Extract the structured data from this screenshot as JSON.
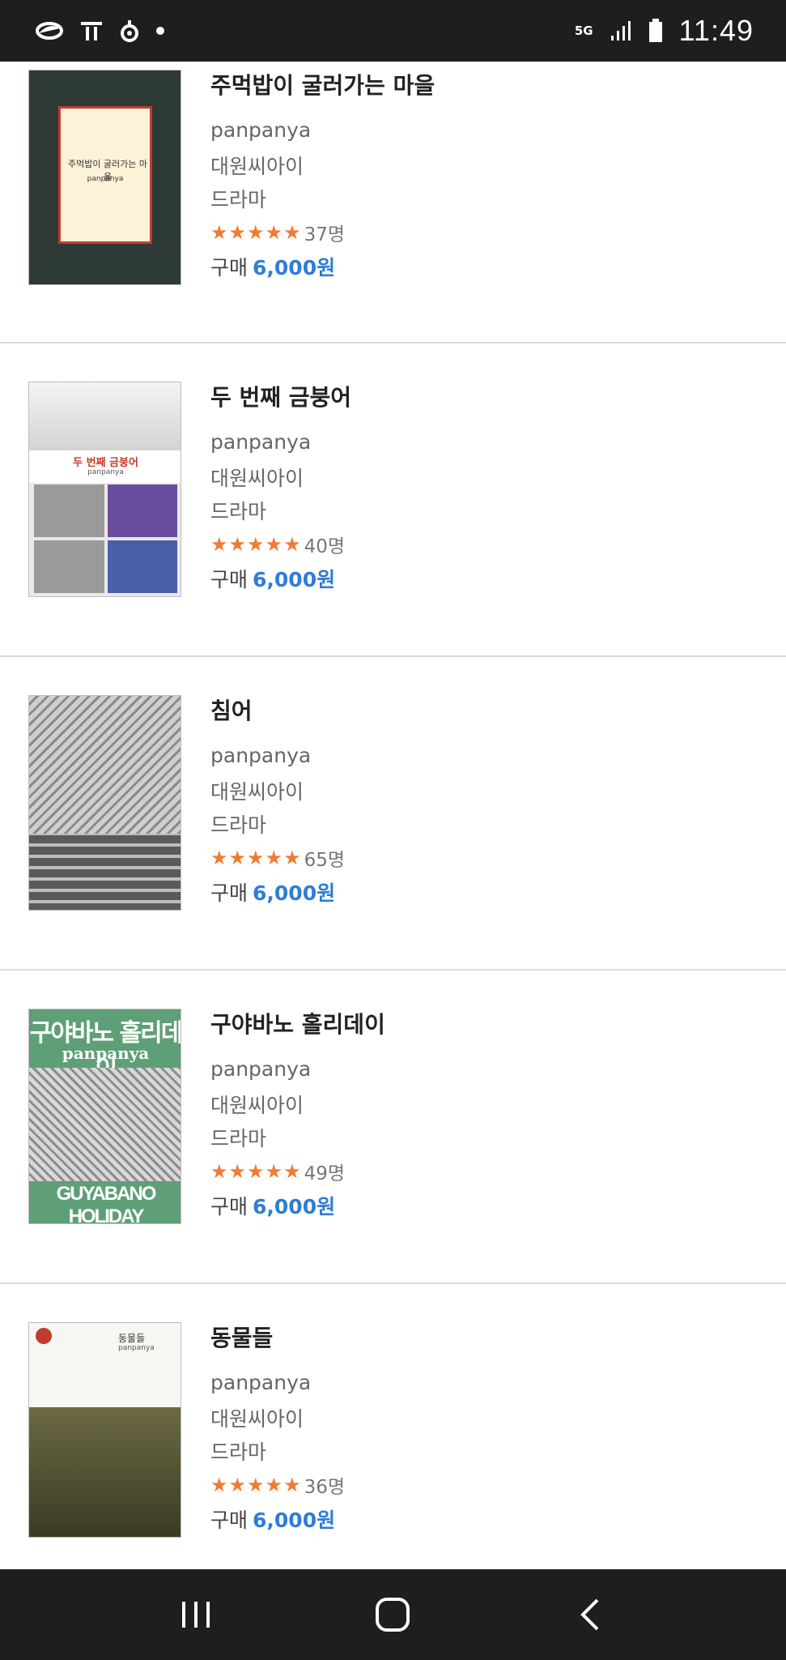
{
  "status_bar": {
    "time": "11:49",
    "network": "5G",
    "icons_left": [
      "lens-icon",
      "t-icon",
      "bixby-icon",
      "dot-icon"
    ],
    "icons_right": [
      "5g-icon",
      "signal-icon",
      "battery-icon"
    ]
  },
  "books": [
    {
      "title": "주먹밥이 굴러가는 마을",
      "author": "panpanya",
      "publisher": "대원씨아이",
      "genre": "드라마",
      "rating_count": "37명",
      "price_label": "구매",
      "price": "6,000원",
      "cover_text": "주먹밥이 굴러가는 마을",
      "cover_sub": "panpanya"
    },
    {
      "title": "두 번째 금붕어",
      "author": "panpanya",
      "publisher": "대원씨아이",
      "genre": "드라마",
      "rating_count": "40명",
      "price_label": "구매",
      "price": "6,000원",
      "cover_text": "두 번째 금붕어",
      "cover_sub": "panpanya"
    },
    {
      "title": "침어",
      "author": "panpanya",
      "publisher": "대원씨아이",
      "genre": "드라마",
      "rating_count": "65명",
      "price_label": "구매",
      "price": "6,000원"
    },
    {
      "title": "구야바노 홀리데이",
      "author": "panpanya",
      "publisher": "대원씨아이",
      "genre": "드라마",
      "rating_count": "49명",
      "price_label": "구매",
      "price": "6,000원",
      "cover_text": "구야바노 홀리데이",
      "cover_sub": "panpanya",
      "cover_bottom": "GUYABANO HOLIDAY"
    },
    {
      "title": "동물들",
      "author": "panpanya",
      "publisher": "대원씨아이",
      "genre": "드라마",
      "rating_count": "36명",
      "price_label": "구매",
      "price": "6,000원",
      "cover_text": "동물들",
      "cover_sub": "panpanya"
    }
  ],
  "colors": {
    "star": "#f07b34",
    "price": "#2e7dd6",
    "bars": "#1e1e1e"
  },
  "nav_bar": {
    "buttons": [
      "recents-icon",
      "home-icon",
      "back-icon"
    ]
  }
}
